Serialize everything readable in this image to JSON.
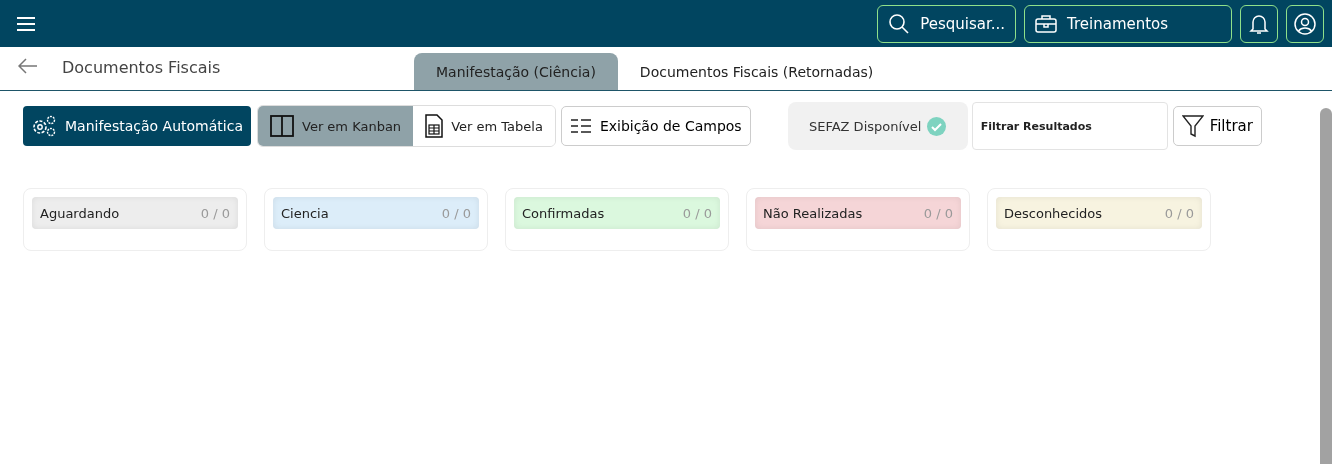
{
  "header": {
    "search_label": "Pesquisar...",
    "training_label": "Treinamentos"
  },
  "page": {
    "title": "Documentos Fiscais"
  },
  "tabs": [
    {
      "label": "Manifestação (Ciência)",
      "selected": true
    },
    {
      "label": "Documentos Fiscais (Retornadas)",
      "selected": false
    }
  ],
  "toolbar": {
    "auto_button": "Manifestação Automática",
    "views": [
      {
        "label": "Ver em Kanban",
        "kind": "kanban",
        "selected": true
      },
      {
        "label": "Ver em Tabela",
        "kind": "table",
        "selected": false
      }
    ],
    "fields_button": "Exibição de Campos",
    "sefaz_status": "SEFAZ Disponível",
    "filter_field": {
      "value": "Filtrar Resultados"
    },
    "filter_button": "Filtrar"
  },
  "columns": [
    {
      "name": "Aguardando",
      "count": "0 / 0",
      "color": "#ededed"
    },
    {
      "name": "Ciencia",
      "count": "0 / 0",
      "color": "#dcedf9"
    },
    {
      "name": "Confirmadas",
      "count": "0 / 0",
      "color": "#dbf8de"
    },
    {
      "name": "Não Realizadas",
      "count": "0 / 0",
      "color": "#f5d5d7"
    },
    {
      "name": "Desconhecidos",
      "count": "0 / 0",
      "color": "#f7f3e0"
    }
  ]
}
